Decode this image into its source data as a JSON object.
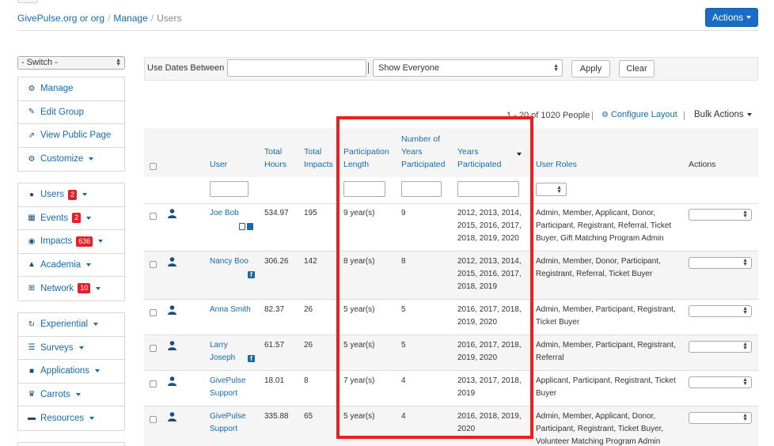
{
  "breadcrumb": {
    "org": "GivePulse.org or org",
    "manage": "Manage",
    "current": "Users",
    "sep": "/"
  },
  "header": {
    "actions_label": "Actions"
  },
  "sidebar": {
    "switch_label": "- Switch -",
    "group1": [
      {
        "label": "Manage",
        "icon": "gears-icon"
      },
      {
        "label": "Edit Group",
        "icon": "pencil-icon"
      },
      {
        "label": "View Public Page",
        "icon": "external-link-icon"
      },
      {
        "label": "Customize",
        "icon": "gears-icon"
      }
    ],
    "group2": [
      {
        "label": "Users",
        "icon": "user-icon",
        "badge": "2"
      },
      {
        "label": "Events",
        "icon": "calendar-icon",
        "badge": "2"
      },
      {
        "label": "Impacts",
        "icon": "dashboard-icon",
        "badge": "636"
      },
      {
        "label": "Academia",
        "icon": "graduation-cap-icon"
      },
      {
        "label": "Network",
        "icon": "sitemap-icon",
        "badge": "10"
      }
    ],
    "group3": [
      {
        "label": "Experiential",
        "icon": "refresh-icon"
      },
      {
        "label": "Surveys",
        "icon": "list-icon"
      },
      {
        "label": "Applications",
        "icon": "briefcase-icon"
      },
      {
        "label": "Carrots",
        "icon": "trophy-icon"
      },
      {
        "label": "Resources",
        "icon": "folder-icon"
      }
    ]
  },
  "filters": {
    "dates_label": "Use Dates Between",
    "date_value": "",
    "show_select": "Show Everyone",
    "apply_label": "Apply",
    "clear_label": "Clear"
  },
  "toolbar": {
    "count_text": "1 - 20 of 1020 People",
    "configure_label": "Configure Layout",
    "bulk_label": "Bulk Actions"
  },
  "columns": {
    "user": "User",
    "total_hours": [
      "Total",
      "Hours"
    ],
    "total_impacts": [
      "Total",
      "Impacts"
    ],
    "participation_length": [
      "Participation",
      "Length"
    ],
    "num_years": [
      "Number of",
      "Years",
      "Participated"
    ],
    "years_participated": [
      "Years",
      "Participated"
    ],
    "user_roles": "User Roles",
    "actions": "Actions"
  },
  "rows": [
    {
      "name": [
        "Joe Bob"
      ],
      "hours": "534.97",
      "impacts": "195",
      "length": "9 year(s)",
      "num_years": "9",
      "years": [
        "2012, 2013, 2014,",
        "2015, 2016, 2017,",
        "2018, 2019, 2020"
      ],
      "roles": [
        "Admin, Member, Applicant, Donor,",
        "Participant, Registrant, Referral, Ticket",
        "Buyer, Gift Matching Program Admin"
      ]
    },
    {
      "name": [
        "Nancy Boo"
      ],
      "hours": "306.26",
      "impacts": "142",
      "length": "8 year(s)",
      "num_years": "8",
      "years": [
        "2012, 2013, 2014,",
        "2015, 2016, 2017,",
        "2018, 2019"
      ],
      "roles": [
        "Admin, Member, Donor, Participant,",
        "Registrant, Referral, Ticket Buyer"
      ]
    },
    {
      "name": [
        "Anna Smith"
      ],
      "hours": "82.37",
      "impacts": "26",
      "length": "5 year(s)",
      "num_years": "5",
      "years": [
        "2016, 2017, 2018,",
        "2019, 2020"
      ],
      "roles": [
        "Admin, Member, Participant, Registrant,",
        "Ticket Buyer"
      ]
    },
    {
      "name": [
        "Larry",
        "Joseph"
      ],
      "hours": "61.57",
      "impacts": "26",
      "length": "5 year(s)",
      "num_years": "5",
      "years": [
        "2016, 2017, 2018,",
        "2019, 2020"
      ],
      "roles": [
        "Admin, Member, Participant, Registrant,",
        "Referral"
      ]
    },
    {
      "name": [
        "GivePulse",
        "Support"
      ],
      "hours": "18.01",
      "impacts": "8",
      "length": "7 year(s)",
      "num_years": "4",
      "years": [
        "2013, 2017, 2018,",
        "2019"
      ],
      "roles": [
        "Applicant, Participant, Registrant, Ticket",
        "Buyer"
      ]
    },
    {
      "name": [
        "GivePulse",
        "Support"
      ],
      "hours": "335.88",
      "impacts": "65",
      "length": "5 year(s)",
      "num_years": "4",
      "years": [
        "2016, 2018, 2019,",
        "2020"
      ],
      "roles": [
        "Admin, Member, Applicant, Donor,",
        "Participant, Registrant, Ticket Buyer,",
        "Volunteer Matching Program Admin"
      ]
    }
  ],
  "colors": {
    "primary": "#1a6cc4",
    "link": "#1a6aa8",
    "badge": "#e2202c",
    "highlight": "#ec2020"
  }
}
